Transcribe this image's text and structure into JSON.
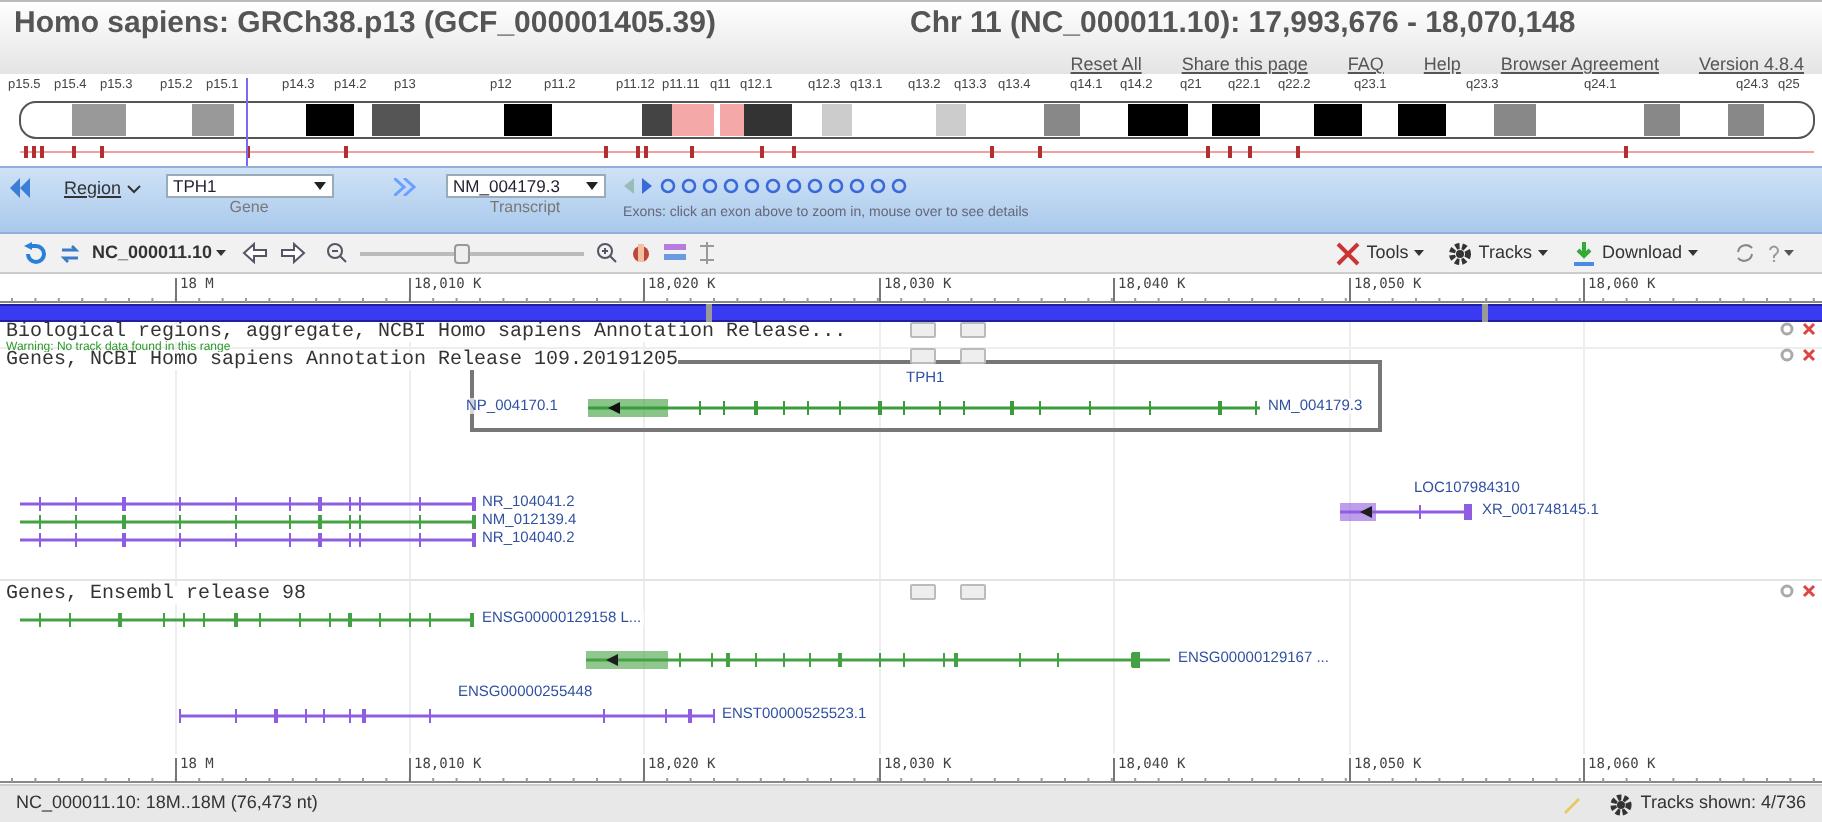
{
  "header": {
    "organism": "Homo sapiens: GRCh38.p13 (GCF_000001405.39)",
    "location": "Chr 11 (NC_000011.10): 17,993,676 - 18,070,148",
    "links": [
      "Reset All",
      "Share this page",
      "FAQ",
      "Help",
      "Browser Agreement",
      "Version 4.8.4"
    ]
  },
  "ideogram": {
    "bands": [
      "p15.5",
      "p15.4",
      "p15.3",
      "p15.2",
      "p15.1",
      "p14.3",
      "p14.2",
      "p13",
      "p12",
      "p11.2",
      "p11.12",
      "p11.11",
      "q11",
      "q12.1",
      "q12.3",
      "q13.1",
      "q13.2",
      "q13.3",
      "q13.4",
      "q14.1",
      "q14.2",
      "q21",
      "q22.1",
      "q22.2",
      "q23.1",
      "q23.3",
      "q24.1",
      "q24.3",
      "q25"
    ]
  },
  "navigator": {
    "region": "Region",
    "gene": {
      "value": "TPH1",
      "caption": "Gene"
    },
    "transcript": {
      "value": "NM_004179.3",
      "caption": "Transcript"
    },
    "exons_hint": "Exons: click an exon above to zoom in, mouse over to see details"
  },
  "toolbar": {
    "sequence": "NC_000011.10",
    "zoom": {
      "level": 0.45
    },
    "menus": [
      "Tools",
      "Tracks",
      "Download"
    ]
  },
  "ruler": {
    "ticks": [
      "18 M",
      "18,010 K",
      "18,020 K",
      "18,030 K",
      "18,040 K",
      "18,050 K",
      "18,060 K"
    ]
  },
  "bottom_ruler": {
    "ticks": [
      "18 M",
      "18,010 K",
      "18,020 K",
      "18,030 K",
      "18,040 K",
      "18,050 K",
      "18,060 K"
    ]
  },
  "tracks": [
    {
      "title": "Biological regions, aggregate, NCBI Homo sapiens Annotation Release...",
      "warning": "Warning: No track data found in this range"
    },
    {
      "title": "Genes, NCBI Homo sapiens Annotation Release 109.20191205",
      "features": [
        {
          "gene": "TPH1",
          "protein": "NP_004170.1",
          "transcript": "NM_004179.3",
          "color": "#3a9c3a",
          "selected": true
        },
        {
          "transcript": "NR_104041.2",
          "color": "#8a55e0",
          "selected": false
        },
        {
          "transcript": "NM_012139.4",
          "color": "#3a9c3a",
          "selected": false
        },
        {
          "transcript": "NR_104040.2",
          "color": "#8a55e0",
          "selected": false
        },
        {
          "gene": "LOC107984310",
          "transcript": "XR_001748145.1",
          "color": "#8a55e0",
          "selected": false
        }
      ]
    },
    {
      "title": "Genes, Ensembl release 98",
      "features": [
        {
          "transcript": "ENSG00000129158 L...",
          "color": "#3a9c3a",
          "selected": false
        },
        {
          "transcript": "ENSG00000129167 ...",
          "color": "#3a9c3a",
          "selected": false
        },
        {
          "gene": "ENSG00000255448",
          "transcript": "ENST00000525523.1",
          "color": "#8a55e0",
          "selected": false
        }
      ]
    }
  ],
  "status_bar": {
    "location": "NC_000011.10: 18M..18M (76,473 nt)",
    "tracks_shown": "Tracks shown: 4/736"
  }
}
